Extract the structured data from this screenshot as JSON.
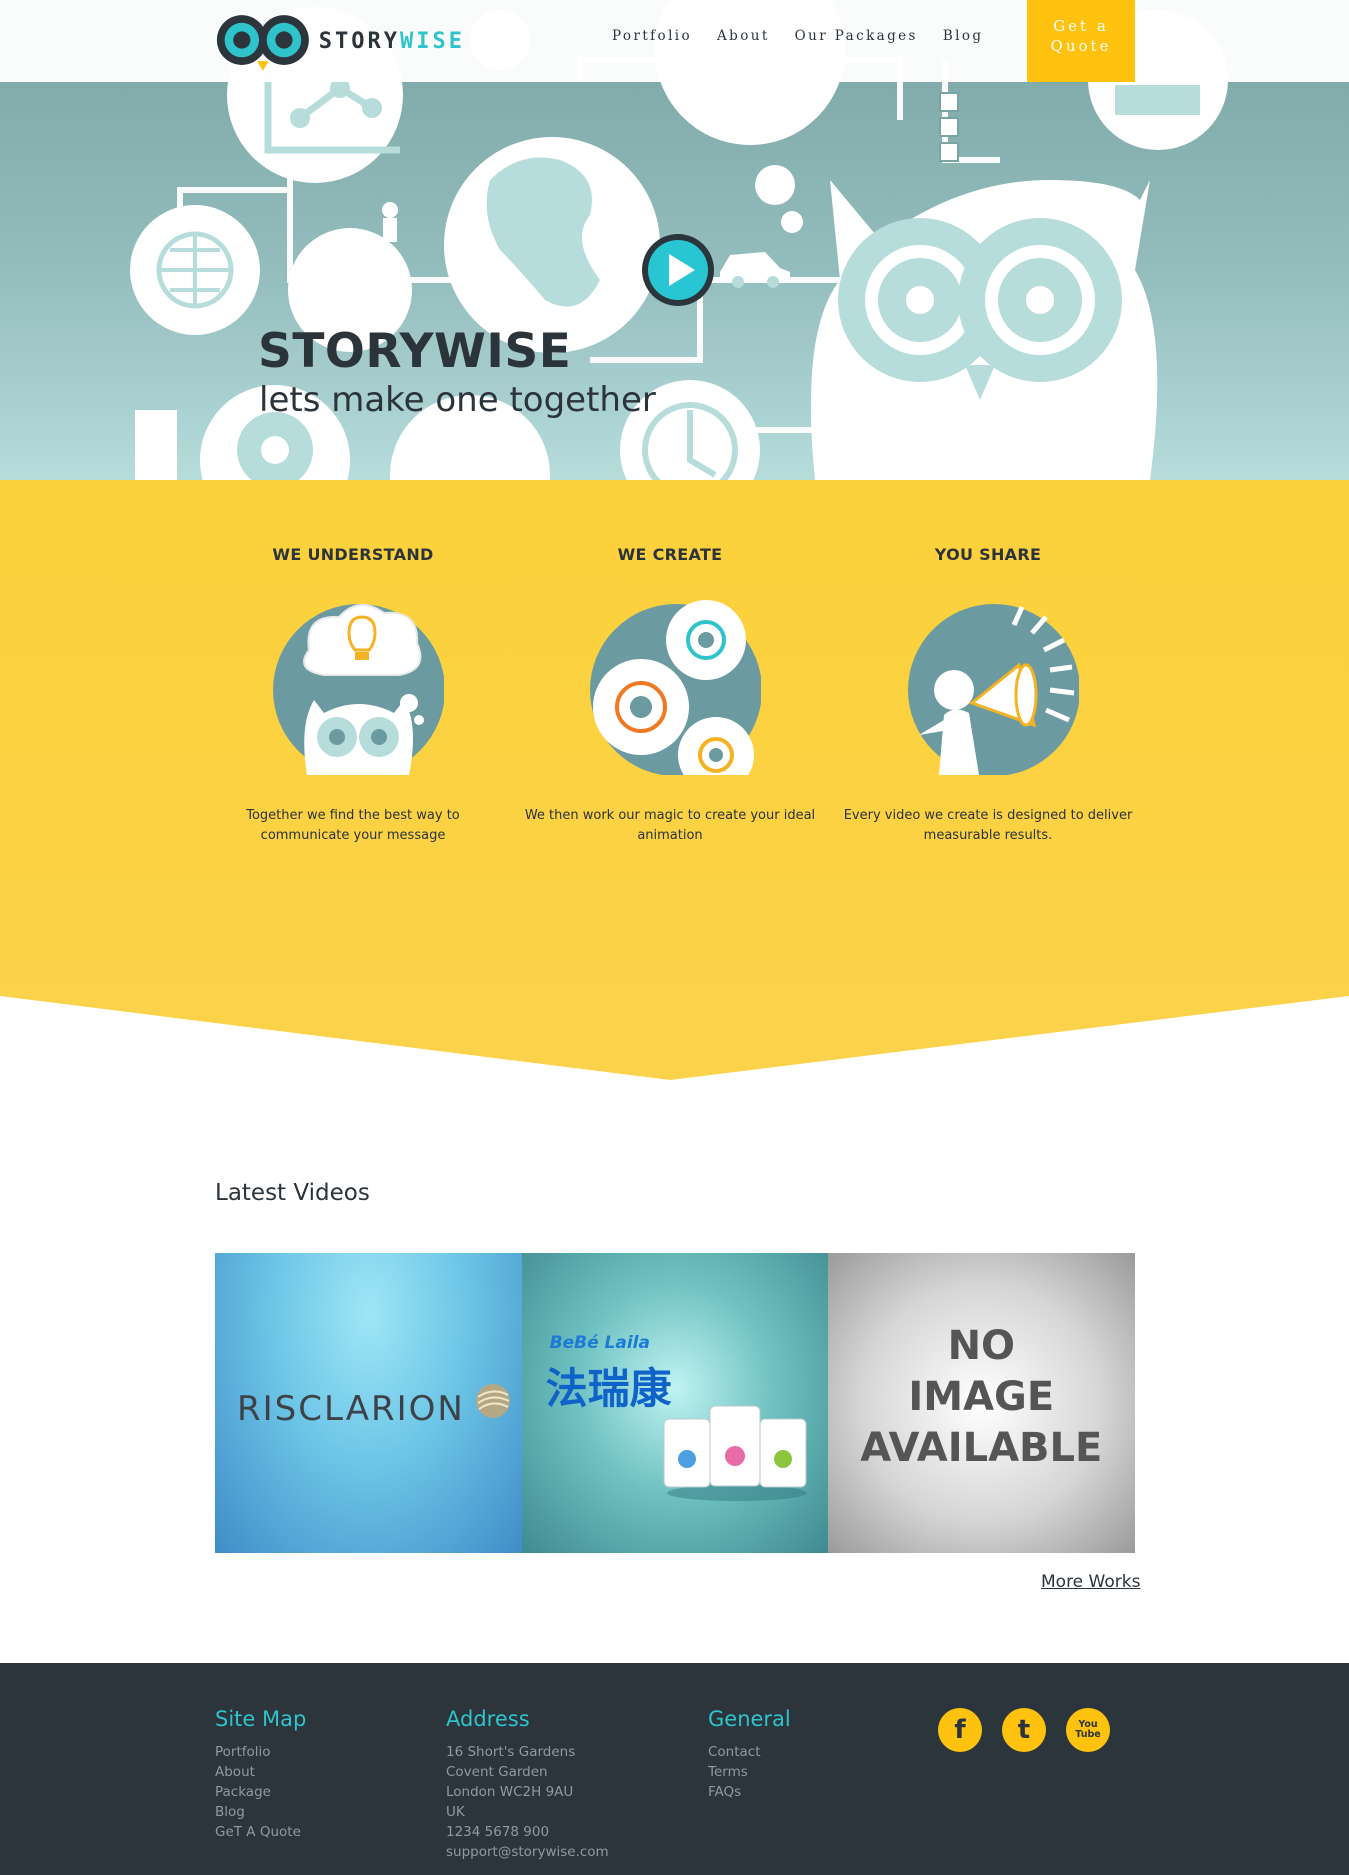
{
  "header": {
    "logo_text_a": "STORY",
    "logo_text_b": "WISE",
    "nav": [
      "Portfolio",
      "About",
      "Our Packages",
      "Blog"
    ],
    "quote_line1": "Get a",
    "quote_line2": "Quote"
  },
  "hero": {
    "title": "STORYWISE",
    "subtitle": "lets make one together",
    "play_icon": "play-icon"
  },
  "features": [
    {
      "title": "WE UNDERSTAND",
      "text": "Together we find the best way to communicate your message",
      "icon": "owl-lightbulb-icon"
    },
    {
      "title": "WE CREATE",
      "text": "We then work our magic to create your ideal animation",
      "icon": "gears-icon"
    },
    {
      "title": "YOU SHARE",
      "text": "Every video we create is designed to deliver measurable results.",
      "icon": "megaphone-icon"
    }
  ],
  "latest": {
    "title": "Latest Videos",
    "videos": [
      {
        "label": "RISCLARION"
      },
      {
        "label": "法瑞康",
        "sub": "BeBé Laila"
      },
      {
        "label_lines": [
          "NO",
          "IMAGE",
          "AVAILABLE"
        ]
      }
    ],
    "more": "More Works"
  },
  "footer": {
    "sitemap": {
      "title": "Site Map",
      "links": [
        "Portfolio",
        "About",
        "Package",
        "Blog",
        "GeT A Quote"
      ]
    },
    "address": {
      "title": "Address",
      "lines": [
        "16 Short's Gardens",
        "Covent Garden",
        "London WC2H 9AU",
        "UK",
        "1234 5678 900",
        "support@storywise.com"
      ]
    },
    "general": {
      "title": "General",
      "links": [
        "Contact",
        "Terms",
        "FAQs"
      ]
    },
    "social": [
      "f",
      "t",
      "You Tube"
    ],
    "social_icons": [
      "facebook-icon",
      "twitter-icon",
      "youtube-icon"
    ]
  },
  "colors": {
    "accent": "#ffc20e",
    "teal": "#2fc3cc",
    "dark": "#2c343c",
    "hero": "#93bcbc"
  }
}
